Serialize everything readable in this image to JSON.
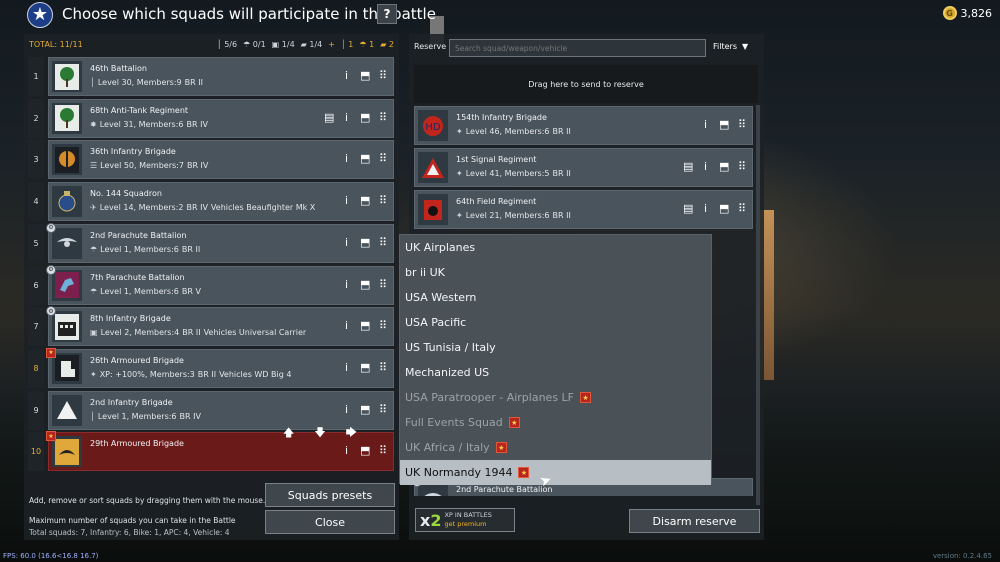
{
  "header": {
    "title": "Choose which squads will participate in the battle",
    "help": "?",
    "emblem": "star-emblem",
    "gold": "3,826"
  },
  "totals": {
    "label": "TOTAL: 11/11",
    "stats": [
      "5/6",
      "0/1",
      "1/4",
      "1/4",
      "+",
      "1",
      "1",
      "2"
    ]
  },
  "squads": [
    {
      "num": "1",
      "name": "46th Battalion",
      "info": "Level 30, Members:9",
      "br": "BR II",
      "icon": "rifle-icon",
      "emblem": "tree",
      "badge": "",
      "extra": ""
    },
    {
      "num": "2",
      "name": "68th Anti-Tank Regiment",
      "info": "Level 31, Members:6",
      "br": "BR IV",
      "icon": "at-icon",
      "emblem": "tree",
      "badge": "",
      "extra": ""
    },
    {
      "num": "3",
      "name": "36th Infantry Brigade",
      "info": "Level 50, Members:7",
      "br": "BR IV",
      "icon": "mg-icon",
      "emblem": "axe",
      "badge": "",
      "extra": ""
    },
    {
      "num": "4",
      "name": "No. 144 Squadron",
      "info": "Level 14, Members:2",
      "br": "BR IV",
      "icon": "plane-icon",
      "emblem": "raf",
      "badge": "",
      "extra": "Vehicles Beaufighter Mk X"
    },
    {
      "num": "5",
      "name": "2nd Parachute Battalion",
      "info": "Level 1, Members:6",
      "br": "BR II",
      "icon": "para-icon",
      "emblem": "wings",
      "badge": "gear",
      "extra": ""
    },
    {
      "num": "6",
      "name": "7th Parachute Battalion",
      "info": "Level 1, Members:6",
      "br": "BR V",
      "icon": "para-icon",
      "emblem": "pegasus",
      "badge": "gear",
      "extra": ""
    },
    {
      "num": "7",
      "name": "8th Infantry Brigade",
      "info": "Level 2, Members:4",
      "br": "BR II",
      "icon": "vehicle-icon",
      "emblem": "castle",
      "badge": "gear",
      "extra": "Vehicles Universal Carrier"
    },
    {
      "num": "8",
      "name": "26th Armoured Brigade",
      "info": "XP: +100%, Members:3",
      "br": "BR II",
      "icon": "tank-icon",
      "emblem": "fist",
      "badge": "premium",
      "extra": "Vehicles WD Big 4"
    },
    {
      "num": "9",
      "name": "2nd Infantry Brigade",
      "info": "Level 1, Members:6",
      "br": "BR IV",
      "icon": "rifle-icon",
      "emblem": "triangle",
      "badge": "",
      "extra": ""
    },
    {
      "num": "10",
      "name": "29th Armoured Brigade",
      "info": "",
      "br": "",
      "icon": "",
      "emblem": "bull",
      "badge": "premium",
      "extra": ""
    }
  ],
  "help": {
    "drag_text": "Add, remove or sort squads by dragging them with the mouse.",
    "max_text": "Maximum number of squads you can take in the Battle",
    "limits": "Total squads: 7, Infantry: 6, Bike: 1, APC: 4, Vehicle: 4"
  },
  "buttons": {
    "presets": "Squads presets",
    "close": "Close",
    "disarm": "Disarm reserve"
  },
  "reserve": {
    "label": "Reserve",
    "search_placeholder": "Search squad/weapon/vehicle",
    "filters": "Filters",
    "drop_zone": "Drag here to send to reserve",
    "squads": [
      {
        "name": "154th Infantry Brigade",
        "info": "Level 46, Members:6",
        "br": "BR II",
        "emblem": "hd"
      },
      {
        "name": "1st Signal Regiment",
        "info": "Level 41, Members:5",
        "br": "BR II",
        "emblem": "triangle-red"
      },
      {
        "name": "64th Field Regiment",
        "info": "Level 21, Members:6",
        "br": "BR II",
        "emblem": "cat"
      },
      {
        "name": "2nd Parachute Battalion",
        "info": "",
        "br": "",
        "emblem": "wings"
      }
    ]
  },
  "dropdown": {
    "items": [
      {
        "label": "UK Airplanes",
        "state": "normal",
        "premium": false
      },
      {
        "label": "br ii UK",
        "state": "normal",
        "premium": false
      },
      {
        "label": "USA Western",
        "state": "normal",
        "premium": false
      },
      {
        "label": "USA Pacific",
        "state": "normal",
        "premium": false
      },
      {
        "label": "US Tunisia / Italy",
        "state": "normal",
        "premium": false
      },
      {
        "label": "Mechanized US",
        "state": "normal",
        "premium": false
      },
      {
        "label": "USA Paratrooper - Airplanes LF",
        "state": "dim",
        "premium": true
      },
      {
        "label": "Full Events Squad",
        "state": "dim",
        "premium": true
      },
      {
        "label": "UK Africa / Italy",
        "state": "dim",
        "premium": true
      },
      {
        "label": "UK Normandy 1944",
        "state": "highlighted",
        "premium": true
      }
    ]
  },
  "xp": {
    "mult": "2",
    "line1": "XP IN BATTLES",
    "line2": "get premium"
  },
  "footer": {
    "fps": "FPS: 60.0 (16.6<16.8 16.7)",
    "version": "version: 0.2.4.65"
  },
  "colors": {
    "accent": "#e6ad2c",
    "selected_row": "#6b1a1a",
    "premium_badge": "#b7251f",
    "xp_green": "#9bd83b"
  }
}
